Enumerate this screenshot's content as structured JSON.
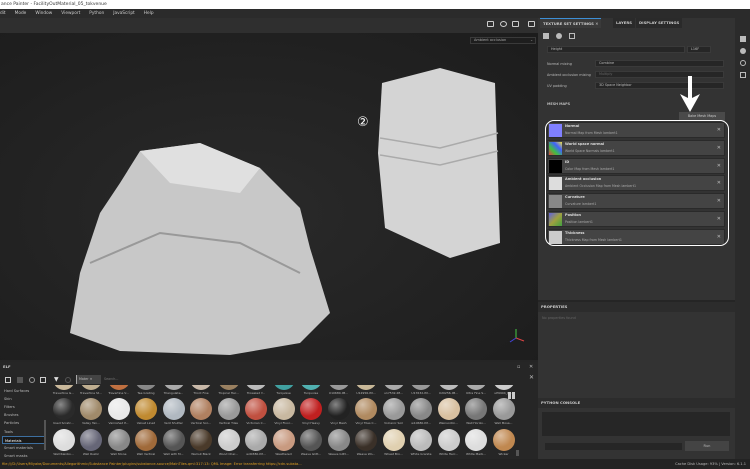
{
  "window": {
    "title": "ance Painter - FacilityOutMaterial_05_tokvenue"
  },
  "menu": [
    "dit",
    "Mode",
    "Window",
    "Viewport",
    "Python",
    "JavaScript",
    "Help"
  ],
  "viewport": {
    "display_dropdown": "Ambient occlusion",
    "annotation": "②",
    "icons": [
      "camera-frame-icon",
      "environment-icon",
      "camera-icon",
      "screenshot-icon"
    ]
  },
  "right_panel": {
    "tabs": [
      {
        "label": "TEXTURE SET SETTINGS",
        "active": true
      },
      {
        "label": "LAYERS"
      },
      {
        "label": "DISPLAY SETTINGS"
      }
    ],
    "channel": {
      "name": "Height",
      "format": "L16F"
    },
    "normal_mixing": {
      "label": "Normal mixing",
      "value": "Combine"
    },
    "ao_mixing": {
      "label": "Ambient occlusion mixing",
      "value": "Multiply"
    },
    "uv_padding": {
      "label": "UV padding",
      "value": "3D Space Neighbor"
    },
    "mesh_maps_title": "MESH MAPS",
    "bake_button": "Bake Mesh Maps",
    "mesh_maps": [
      {
        "name": "Normal",
        "desc": "Normal Map from Mesh lambert1",
        "thumb": "#8080ff"
      },
      {
        "name": "World space normal",
        "desc": "World Space Normals lambert1",
        "thumb": "linear-gradient(45deg,#e04040,#40c040,#4060ff,#f0e040)"
      },
      {
        "name": "ID",
        "desc": "Color Map from Mesh lambert1",
        "thumb": "#000000"
      },
      {
        "name": "Ambient occlusion",
        "desc": "Ambient Occlusion Map from Mesh lambert1",
        "thumb": "#dddddd"
      },
      {
        "name": "Curvature",
        "desc": "Curvature lambert1",
        "thumb": "#888888"
      },
      {
        "name": "Position",
        "desc": "Position lambert1",
        "thumb": "linear-gradient(135deg,#6060e0,#a0a040,#40a040)"
      },
      {
        "name": "Thickness",
        "desc": "Thickness Map from Mesh lambert1",
        "thumb": "#cccccc"
      }
    ]
  },
  "properties": {
    "title": "PROPERTIES",
    "empty": "No properties found"
  },
  "python_console": {
    "title": "PYTHON CONSOLE",
    "run": "Run"
  },
  "shelf": {
    "title": "ELF",
    "filter_tag": "Mater",
    "search_placeholder": "Search...",
    "categories": [
      {
        "label": "Hard Surfaces"
      },
      {
        "label": "Skin"
      },
      {
        "label": "Filters"
      },
      {
        "label": "Brushes"
      },
      {
        "label": "Particles"
      },
      {
        "label": "Tools"
      },
      {
        "label": "Materials",
        "selected": true
      },
      {
        "label": "Smart materials"
      },
      {
        "label": "Smart masks"
      }
    ],
    "rows": [
      [
        [
          "Travertine G...",
          "#c9b89a"
        ],
        [
          "Travertine St...",
          "#bfae90"
        ],
        [
          "Travertine V...",
          "#c07040"
        ],
        [
          "Tee Grating",
          "#888"
        ],
        [
          "Triangulate...",
          "#aaa"
        ],
        [
          "Tricot Fine",
          "#c8b8a8"
        ],
        [
          "Tropical Har...",
          "#9a8060"
        ],
        [
          "Troweled Y...",
          "#bbb"
        ],
        [
          "Turquoise",
          "#40a0a0"
        ],
        [
          "Turquoise",
          "#50b0b0"
        ],
        [
          "U10680-IM...",
          "#999"
        ],
        [
          "U12956-IM...",
          "#c8b898"
        ],
        [
          "u17532-IM...",
          "#aaa"
        ],
        [
          "U17632-IM...",
          "#999"
        ],
        [
          "U20256-IM...",
          "#bbb"
        ],
        [
          "Ultra Fine S...",
          "#aaa"
        ],
        [
          "uP9904_M...",
          "#ccc"
        ]
      ],
      [
        [
          "Used Scratc...",
          "#2a2a2a"
        ],
        [
          "Valley Tan...",
          "#a08a6a"
        ],
        [
          "Varnished P...",
          "#e8e8e8"
        ],
        [
          "Velvet Lined",
          "#c08a30"
        ],
        [
          "Vent Shutter",
          "#b0b8c0"
        ],
        [
          "Vertical Sco...",
          "#b08060"
        ],
        [
          "Vertical Tiles",
          "#999"
        ],
        [
          "Victorian C...",
          "#c05040"
        ],
        [
          "Vinyl Floor...",
          "#c8b8a0"
        ],
        [
          "Vinyl Heavy",
          "#c02020"
        ],
        [
          "Vinyl Mesh",
          "#222"
        ],
        [
          "Vinyl Tiles C...",
          "#b08a60"
        ],
        [
          "Volcanic Soil",
          "#999"
        ],
        [
          "w10680-IM...",
          "#888"
        ],
        [
          "Wainscotin...",
          "#d8c0a0"
        ],
        [
          "Wall Horizo...",
          "#777"
        ],
        [
          "Wall Mosa...",
          "#999"
        ]
      ],
      [
        [
          "Wall Rainbo...",
          "#ddd"
        ],
        [
          "Wall Rustic",
          "#667"
        ],
        [
          "Wall Stone",
          "#888"
        ],
        [
          "Wall Vertical",
          "#a06a3a"
        ],
        [
          "Wall with M...",
          "#555"
        ],
        [
          "Walnut Black",
          "#4a3a2a"
        ],
        [
          "Wood Cher...",
          "#ccc"
        ],
        [
          "wd0380-IM...",
          "#aaa"
        ],
        [
          "Weathered",
          "#c89a80"
        ],
        [
          "Weave Glitt...",
          "#555"
        ],
        [
          "Weave Glitt...",
          "#888"
        ],
        [
          "Weave Wo...",
          "#3a3028"
        ],
        [
          "Wheat Bro...",
          "#e0d0b0"
        ],
        [
          "White Granite",
          "#bbb"
        ],
        [
          "White Herr...",
          "#ccc"
        ],
        [
          "White Marb...",
          "#ddd"
        ],
        [
          "Wicker",
          "#c08850"
        ]
      ]
    ]
  },
  "status": {
    "message": "file:///D:/Users/Miyake/Documents/Allegorithmic/Substance Painter/plugins/substance-source/MainTiles.qml:317:13: QML Image: Error transferring https://cdn.substa...",
    "right": "Cache Disk Usage: 93% | Version: 6.1.1"
  },
  "colors": {
    "accent": "#3d8fd6",
    "status_text": "#e0a020"
  }
}
